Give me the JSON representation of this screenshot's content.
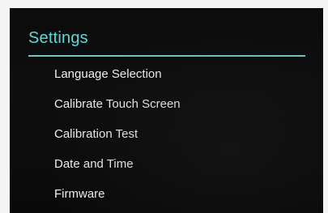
{
  "settings": {
    "title": "Settings",
    "menu": [
      {
        "label": "Language Selection"
      },
      {
        "label": "Calibrate Touch Screen"
      },
      {
        "label": "Calibration Test"
      },
      {
        "label": "Date and Time"
      },
      {
        "label": "Firmware"
      }
    ]
  },
  "colors": {
    "accent": "#62d6d6",
    "background": "#0c0c0c",
    "text": "#f2f2f2"
  }
}
